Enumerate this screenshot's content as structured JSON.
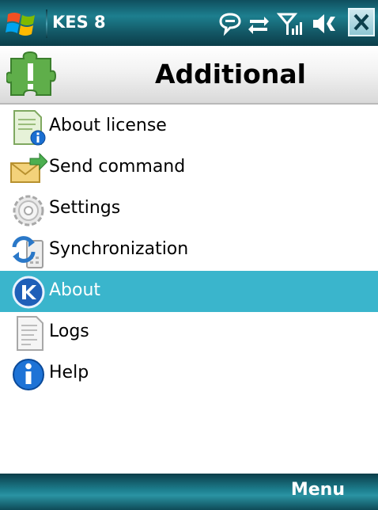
{
  "status_bar": {
    "app_title": "KES 8",
    "icons": [
      "windows-start-icon",
      "messaging-icon",
      "data-connection-icon",
      "signal-strength-icon",
      "volume-icon",
      "close-icon"
    ]
  },
  "header": {
    "title": "Additional",
    "icon": "puzzle-alert-icon"
  },
  "menu_items": [
    {
      "label": "About license",
      "icon": "license-info-icon",
      "selected": false
    },
    {
      "label": "Send command",
      "icon": "send-envelope-icon",
      "selected": false
    },
    {
      "label": "Settings",
      "icon": "gear-icon",
      "selected": false
    },
    {
      "label": "Synchronization",
      "icon": "sync-icon",
      "selected": false
    },
    {
      "label": "About",
      "icon": "kaspersky-logo-icon",
      "selected": true
    },
    {
      "label": "Logs",
      "icon": "log-document-icon",
      "selected": false
    },
    {
      "label": "Help",
      "icon": "help-info-icon",
      "selected": false
    }
  ],
  "bottom_bar": {
    "menu_label": "Menu"
  },
  "colors": {
    "selection": "#3ab5cc",
    "bar_dark": "#0b3d49",
    "bar_light": "#1d7f8f"
  }
}
